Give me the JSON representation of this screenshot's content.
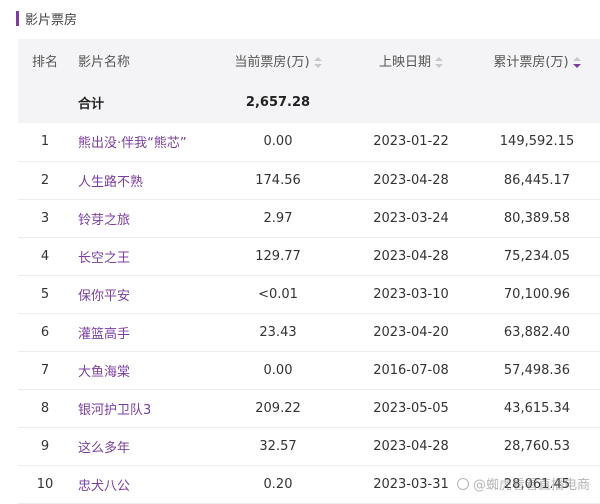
{
  "section": {
    "title": "影片票房"
  },
  "columns": {
    "rank": "排名",
    "name": "影片名称",
    "current": "当前票房(万)",
    "date": "上映日期",
    "total": "累计票房(万)"
  },
  "total_row": {
    "label": "合计",
    "current": "2,657.28"
  },
  "rows": [
    {
      "rank": "1",
      "name": "熊出没·伴我“熊芯”",
      "current": "0.00",
      "date": "2023-01-22",
      "total": "149,592.15"
    },
    {
      "rank": "2",
      "name": "人生路不熟",
      "current": "174.56",
      "date": "2023-04-28",
      "total": "86,445.17"
    },
    {
      "rank": "3",
      "name": "铃芽之旅",
      "current": "2.97",
      "date": "2023-03-24",
      "total": "80,389.58"
    },
    {
      "rank": "4",
      "name": "长空之王",
      "current": "129.77",
      "date": "2023-04-28",
      "total": "75,234.05"
    },
    {
      "rank": "5",
      "name": "保你平安",
      "current": "<0.01",
      "date": "2023-03-10",
      "total": "70,100.96"
    },
    {
      "rank": "6",
      "name": "灌篮高手",
      "current": "23.43",
      "date": "2023-04-20",
      "total": "63,882.40"
    },
    {
      "rank": "7",
      "name": "大鱼海棠",
      "current": "0.00",
      "date": "2016-07-08",
      "total": "57,498.36"
    },
    {
      "rank": "8",
      "name": "银河护卫队3",
      "current": "209.22",
      "date": "2023-05-05",
      "total": "43,615.34"
    },
    {
      "rank": "9",
      "name": "这么多年",
      "current": "32.57",
      "date": "2023-04-28",
      "total": "28,760.53"
    },
    {
      "rank": "10",
      "name": "忠犬八公",
      "current": "0.20",
      "date": "2023-03-31",
      "total": "28,061.45"
    }
  ],
  "watermark": {
    "text": "@蜘虎看看直播电商"
  },
  "colors": {
    "accent": "#7b3fa0",
    "header_bg": "#f4f4f6"
  },
  "sort": {
    "active_column": "total",
    "direction": "descending"
  }
}
